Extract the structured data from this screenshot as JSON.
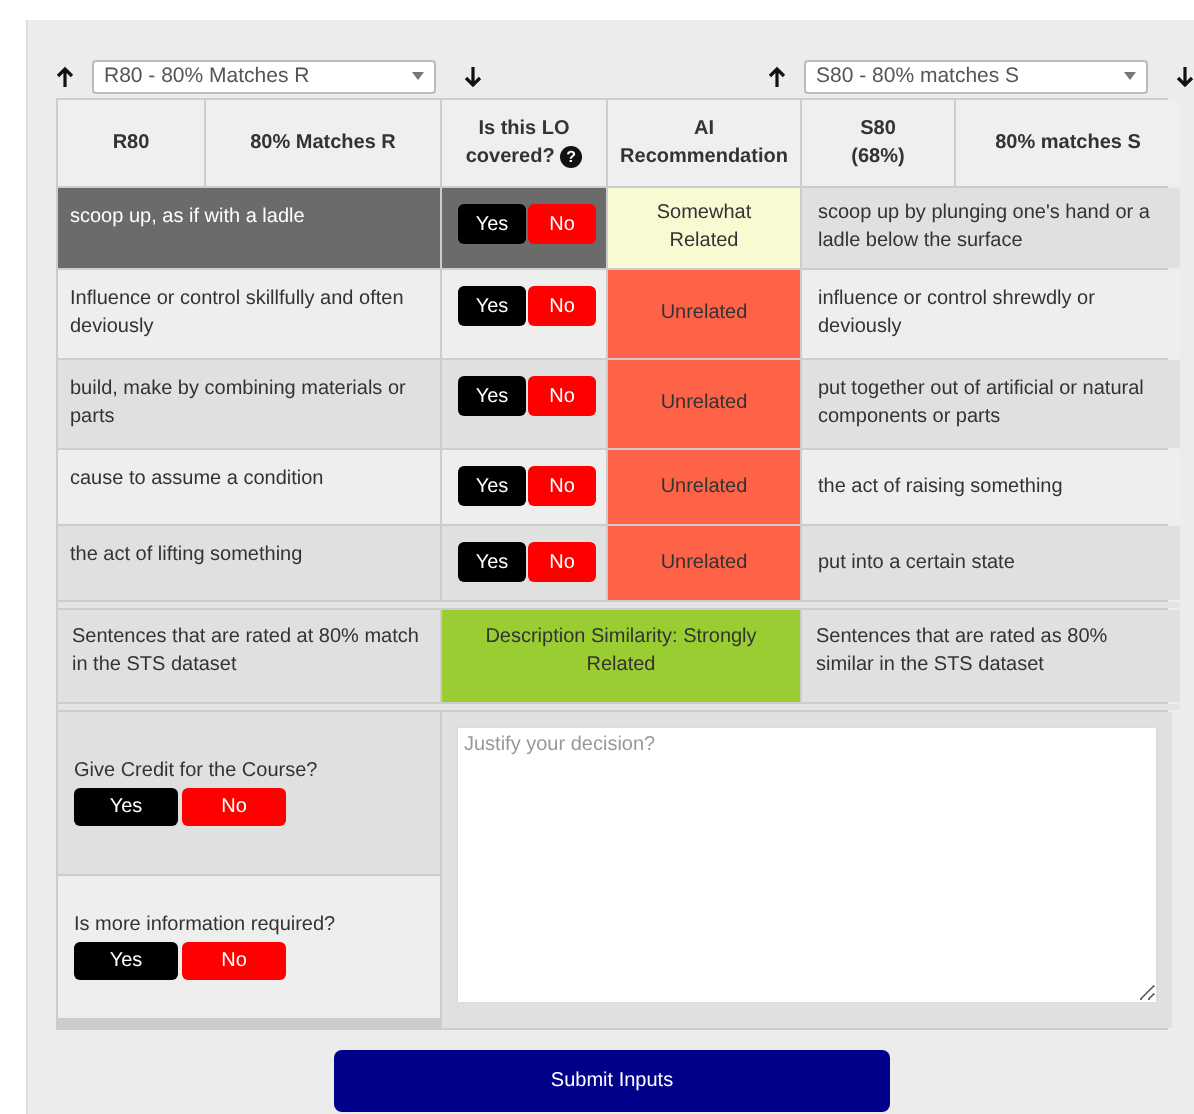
{
  "selectors": [
    {
      "value": "R80 - 80% Matches R"
    },
    {
      "value": "S80 - 80% matches S"
    }
  ],
  "table": {
    "columns": [
      "R80",
      "80% Matches R",
      "Is this LO covered?",
      "AI Recommendation",
      "S80\n(68%)",
      "80% matches S"
    ],
    "help_mark": "?",
    "rows": [
      {
        "r_text": "scoop up, as if with a ladle",
        "buttons": [
          "Yes",
          "No"
        ],
        "recommendation": "Somewhat Related",
        "color": "#fafad2",
        "s_text": "scoop up by plunging one's hand or a ladle below the surface",
        "selected": true
      },
      {
        "r_text": "Influence or control skillfully and often deviously",
        "buttons": [
          "Yes",
          "No"
        ],
        "recommendation": "Unrelated",
        "color": "#ff6347",
        "s_text": "influence or control shrewdly or deviously",
        "selected": false
      },
      {
        "r_text": "build, make by combining materials or parts",
        "buttons": [
          "Yes",
          "No"
        ],
        "recommendation": "Unrelated",
        "color": "#ff6347",
        "s_text": "put together out of artificial or natural components or parts",
        "selected": false
      },
      {
        "r_text": "cause to assume a condition",
        "buttons": [
          "Yes",
          "No"
        ],
        "recommendation": "Unrelated",
        "color": "#ff6347",
        "s_text": "the act of raising something",
        "selected": false
      },
      {
        "r_text": "the act of lifting something",
        "buttons": [
          "Yes",
          "No"
        ],
        "recommendation": "Unrelated",
        "color": "#ff6347",
        "s_text": "put into a certain state",
        "selected": false
      }
    ]
  },
  "summary": {
    "left": "Sentences that are rated at 80% match in the STS dataset",
    "middle": "Description Similarity: Strongly Related",
    "right": "Sentences that are rated as 80% similar in the STS dataset"
  },
  "decision": {
    "questions": [
      {
        "label": "Give Credit for the Course?",
        "buttons": [
          "Yes",
          "No"
        ]
      },
      {
        "label": "Is more information required?",
        "buttons": [
          "Yes",
          "No"
        ]
      }
    ],
    "justification": {
      "placeholder": "Justify your decision?"
    }
  },
  "submit": "Submit Inputs"
}
